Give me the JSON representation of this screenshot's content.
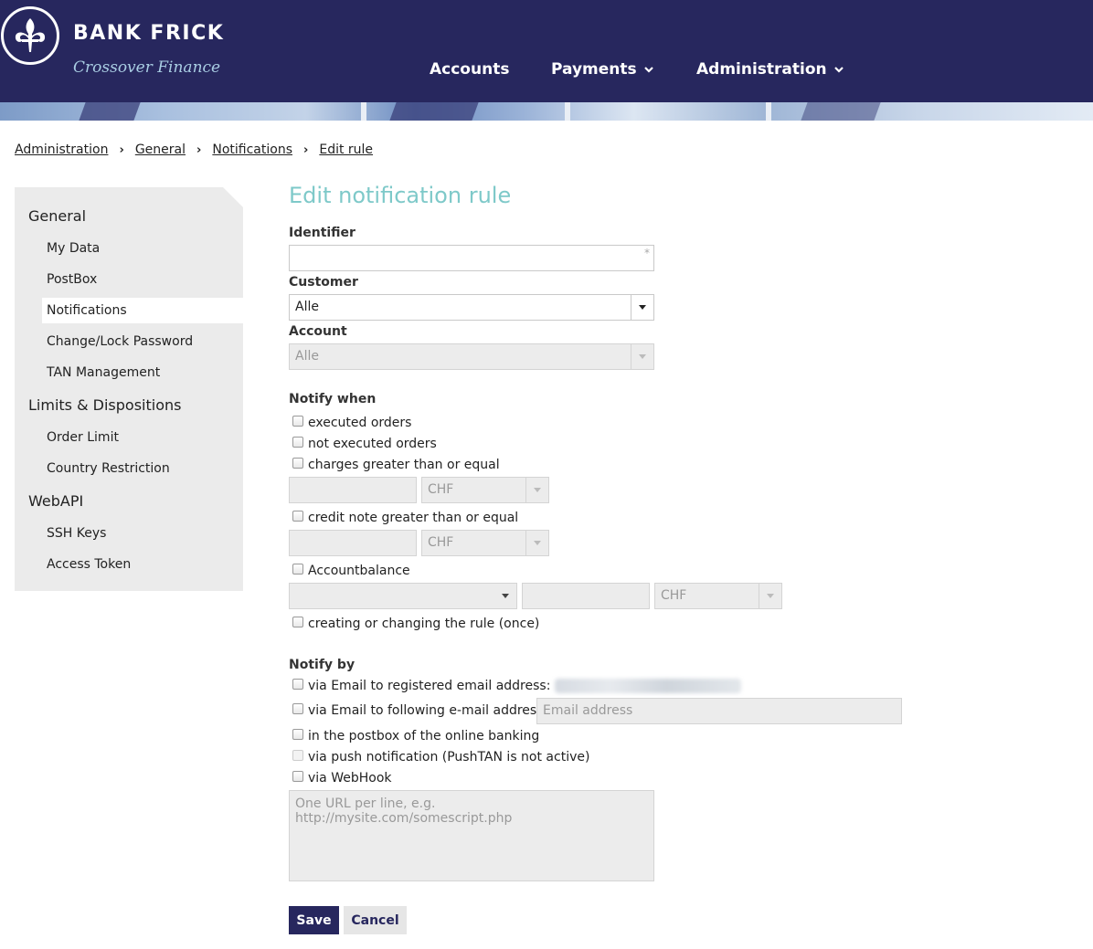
{
  "brand": {
    "name": "BANK FRICK",
    "tagline": "Crossover Finance"
  },
  "nav": [
    {
      "label": "Accounts",
      "has_dropdown": false
    },
    {
      "label": "Payments",
      "has_dropdown": true
    },
    {
      "label": "Administration",
      "has_dropdown": true
    }
  ],
  "breadcrumb": [
    "Administration",
    "General",
    "Notifications",
    "Edit rule"
  ],
  "sidebar": {
    "groups": [
      {
        "label": "General",
        "items": [
          "My Data",
          "PostBox",
          "Notifications",
          "Change/Lock Password",
          "TAN Management"
        ]
      },
      {
        "label": "Limits & Dispositions",
        "items": [
          "Order Limit",
          "Country Restriction"
        ]
      },
      {
        "label": "WebAPI",
        "items": [
          "SSH Keys",
          "Access Token"
        ]
      }
    ],
    "active_item": "Notifications"
  },
  "form": {
    "title": "Edit notification rule",
    "identifier": {
      "label": "Identifier",
      "value": "",
      "required_mark": "*"
    },
    "customer": {
      "label": "Customer",
      "value": "Alle"
    },
    "account": {
      "label": "Account",
      "value": "Alle",
      "disabled": true
    },
    "notify_when": {
      "label": "Notify when",
      "executed_orders": "executed orders",
      "not_executed_orders": "not executed orders",
      "charges_greater": "charges greater than or equal",
      "charges_currency": "CHF",
      "credit_note_greater": "credit note greater than or equal",
      "credit_currency": "CHF",
      "accountbalance": "Accountbalance",
      "balance_currency": "CHF",
      "rule_change": "creating or changing the rule (once)"
    },
    "notify_by": {
      "label": "Notify by",
      "registered_email": "via Email to registered email address:",
      "following_email": "via Email to following e-mail address:",
      "email_placeholder": "Email address",
      "postbox": "in the postbox of the online banking",
      "push": "via push notification (PushTAN is not active)",
      "webhook": "via WebHook",
      "webhook_placeholder": "One URL per line, e.g. http://mysite.com/somescript.php"
    },
    "save_label": "Save",
    "cancel_label": "Cancel"
  },
  "colors": {
    "header": "#27275e",
    "title": "#7ec9c9",
    "sidebar": "#ebebeb"
  }
}
